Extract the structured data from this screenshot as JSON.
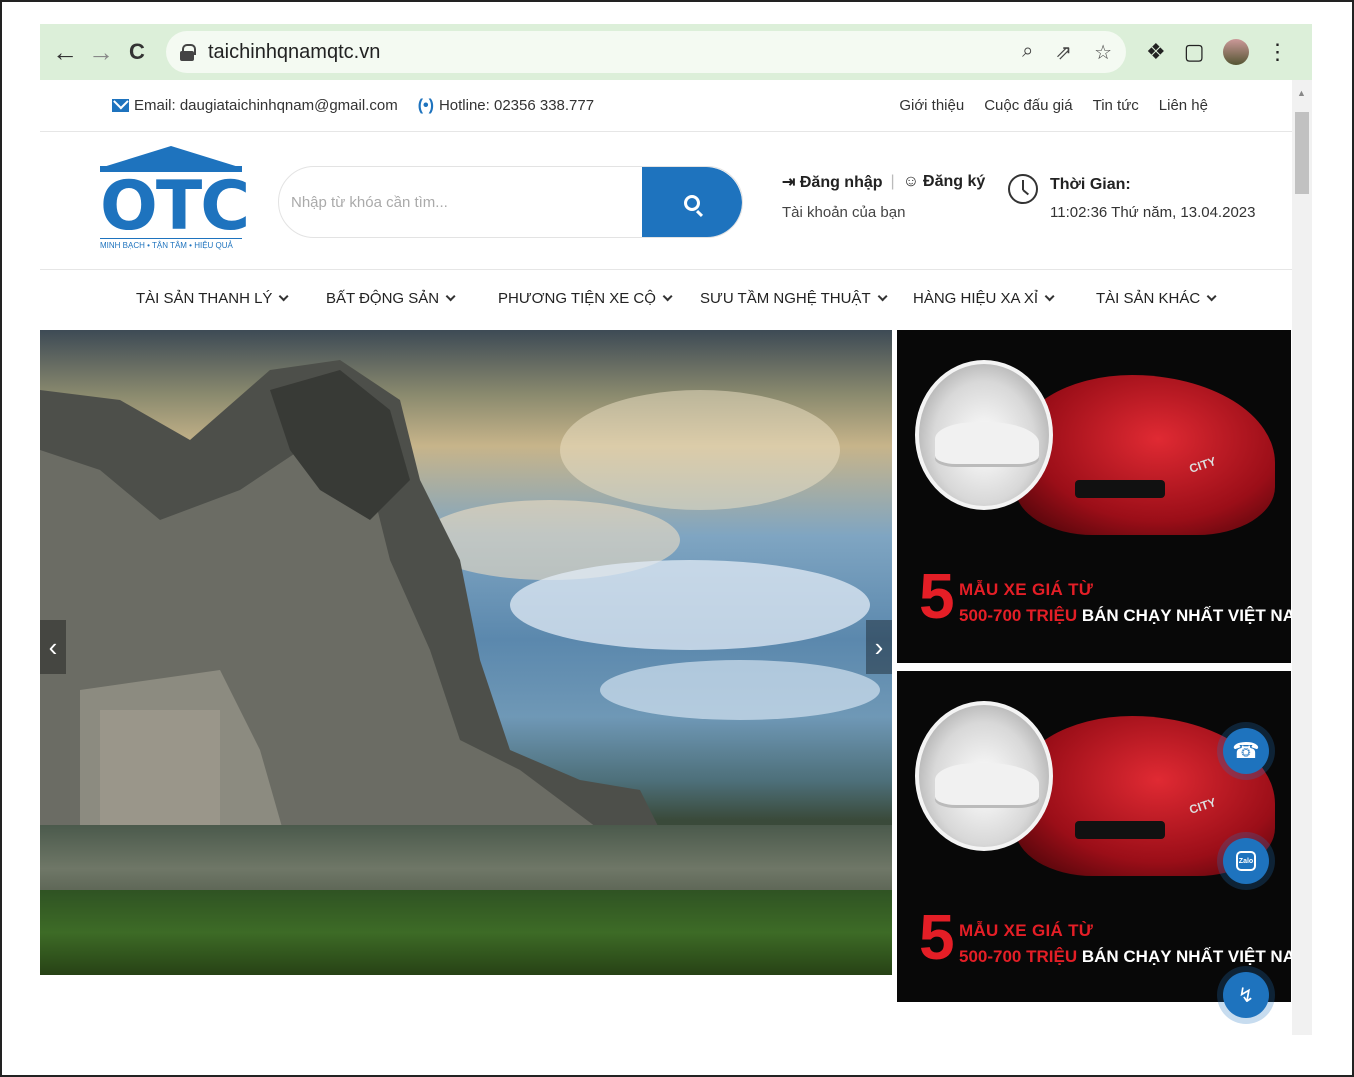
{
  "browser": {
    "url": "taichinhqnamqtc.vn",
    "back_glyph": "←",
    "forward_glyph": "→",
    "reload_glyph": "C"
  },
  "topbar": {
    "email": "Email: daugiataichinhqnam@gmail.com",
    "hotline": "Hotline: 02356 338.777",
    "links": [
      "Giới thiệu",
      "Cuộc đấu giá",
      "Tin tức",
      "Liên hệ"
    ]
  },
  "header": {
    "logo_tagline": "MINH BẠCH • TẬN TÂM • HIỆU QUẢ",
    "search_placeholder": "Nhập từ khóa cần tìm...",
    "login": "Đăng nhập",
    "register": "Đăng ký",
    "account_sub": "Tài khoản của bạn",
    "time_label": "Thời Gian:",
    "time_value": "11:02:36 Thứ năm, 13.04.2023"
  },
  "menu": [
    "TÀI SẢN THANH LÝ",
    "BẤT ĐỘNG SẢN",
    "PHƯƠNG TIỆN XE CỘ",
    "SƯU TẦM NGHỆ THUẬT",
    "HÀNG HIỆU XA XỈ",
    "TÀI SẢN KHÁC"
  ],
  "banner": {
    "number": "5",
    "line1": "MẪU XE GIÁ TỪ",
    "line2_red": "500-700 TRIỆU",
    "line2_white": " BÁN CHẠY NHẤT VIỆT NAM",
    "car_badge": "CITY"
  },
  "float": {
    "zalo": "Zalo"
  },
  "colors": {
    "brand_blue": "#1e73be",
    "chrome_green": "#dcefd9",
    "banner_red": "#e41e26"
  }
}
